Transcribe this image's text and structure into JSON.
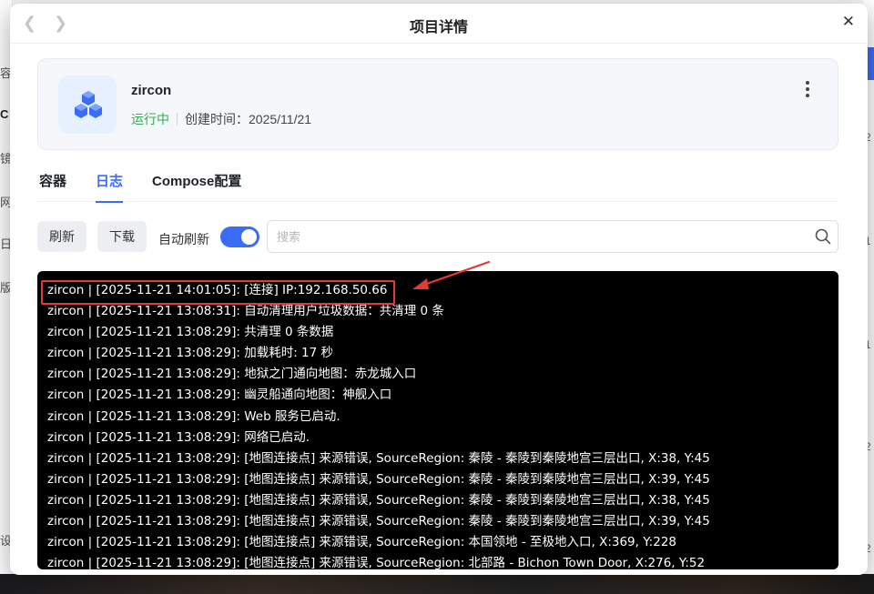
{
  "background": {
    "left_letters": [
      "容",
      "C",
      "镜",
      "网",
      "日",
      "版",
      "设"
    ],
    "right_letters": [
      "2",
      "1",
      "1",
      "2",
      "2"
    ]
  },
  "dialog": {
    "title": "项目详情",
    "back_icon": "chevron-left-icon",
    "forward_icon": "chevron-right-icon",
    "close_glyph": "✕"
  },
  "project": {
    "name": "zircon",
    "status": "运行中",
    "created": "创建时间：2025/11/21",
    "icon": "cubes-icon"
  },
  "tabs": [
    {
      "label": "容器",
      "active": false
    },
    {
      "label": "日志",
      "active": true
    },
    {
      "label": "Compose配置",
      "active": false
    }
  ],
  "toolbar": {
    "refresh_label": "刷新",
    "download_label": "下载",
    "auto_refresh_label": "自动刷新",
    "auto_refresh_on": true,
    "search_placeholder": "搜索"
  },
  "logs": [
    "zircon  | [2025-11-21 14:01:05]: [连接] IP:192.168.50.66",
    "zircon  | [2025-11-21 13:08:31]: 自动清理用户垃圾数据：共清理 0 条",
    "zircon  | [2025-11-21 13:08:29]: 共清理 0 条数据",
    "zircon  | [2025-11-21 13:08:29]: 加载耗时: 17 秒",
    "zircon  | [2025-11-21 13:08:29]: 地狱之门通向地图：赤龙城入口",
    "zircon  | [2025-11-21 13:08:29]: 幽灵船通向地图：神舰入口",
    "zircon  | [2025-11-21 13:08:29]: Web 服务已启动.",
    "zircon  | [2025-11-21 13:08:29]: 网络已启动.",
    "zircon  | [2025-11-21 13:08:29]: [地图连接点] 来源错误, SourceRegion: 秦陵 - 秦陵到秦陵地宫三层出口, X:38, Y:45",
    "zircon  | [2025-11-21 13:08:29]: [地图连接点] 来源错误, SourceRegion: 秦陵 - 秦陵到秦陵地宫三层出口, X:39, Y:45",
    "zircon  | [2025-11-21 13:08:29]: [地图连接点] 来源错误, SourceRegion: 秦陵 - 秦陵到秦陵地宫三层出口, X:38, Y:45",
    "zircon  | [2025-11-21 13:08:29]: [地图连接点] 来源错误, SourceRegion: 秦陵 - 秦陵到秦陵地宫三层出口, X:39, Y:45",
    "zircon  | [2025-11-21 13:08:29]: [地图连接点] 来源错误, SourceRegion: 本国领地 - 至极地入口, X:369, Y:228",
    "zircon  | [2025-11-21 13:08:29]: [地图连接点] 来源错误, SourceRegion: 北部路 - Bichon Town Door, X:276, Y:52"
  ],
  "colors": {
    "accent": "#3b6cf5",
    "running": "#2bb24c",
    "highlight": "#e53935",
    "console_bg": "#000000"
  }
}
